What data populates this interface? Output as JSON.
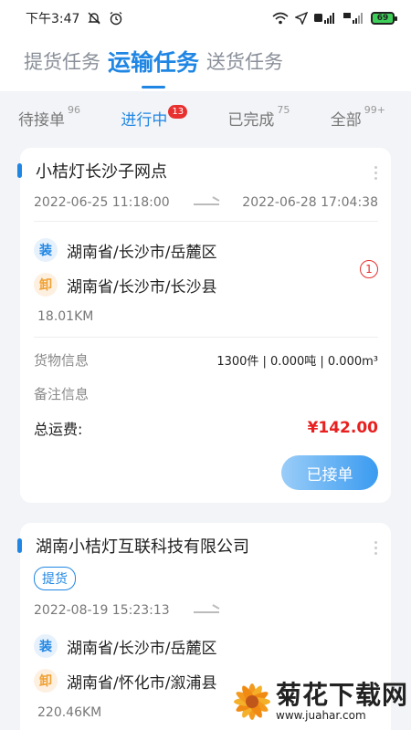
{
  "status_bar": {
    "time": "下午3:47",
    "battery": "69"
  },
  "top_tabs": [
    {
      "label": "提货任务"
    },
    {
      "label": "运输任务"
    },
    {
      "label": "送货任务"
    }
  ],
  "sub_tabs": [
    {
      "label": "待接单",
      "count": "96"
    },
    {
      "label": "进行中",
      "count": "13"
    },
    {
      "label": "已完成",
      "count": "75"
    },
    {
      "label": "全部",
      "count": "99+"
    }
  ],
  "cards": [
    {
      "title": "小桔灯长沙子网点",
      "start_time": "2022-06-25 11:18:00",
      "end_time": "2022-06-28 17:04:38",
      "load_label": "装",
      "load_address": "湖南省/长沙市/岳麓区",
      "unload_label": "卸",
      "unload_address": "湖南省/长沙市/长沙县",
      "step": "1",
      "distance": "18.01KM",
      "cargo_label": "货物信息",
      "cargo_value": "1300件 | 0.000吨 | 0.000m³",
      "remark_label": "备注信息",
      "fee_label": "总运费:",
      "fee_value": "¥142.00",
      "button_label": "已接单"
    },
    {
      "title": "湖南小桔灯互联科技有限公司",
      "tag": "提货",
      "start_time": "2022-08-19 15:23:13",
      "load_label": "装",
      "load_address": "湖南省/长沙市/岳麓区",
      "unload_label": "卸",
      "unload_address": "湖南省/怀化市/溆浦县",
      "distance": "220.46KM"
    }
  ],
  "watermark": {
    "main": "菊花下载网",
    "sub": "www.juahar.com"
  },
  "colors": {
    "accent": "#1f86e4",
    "price": "#e82020",
    "load_icon": "#1f86e4",
    "unload_icon": "#f0a031",
    "badge": "#e83030"
  }
}
